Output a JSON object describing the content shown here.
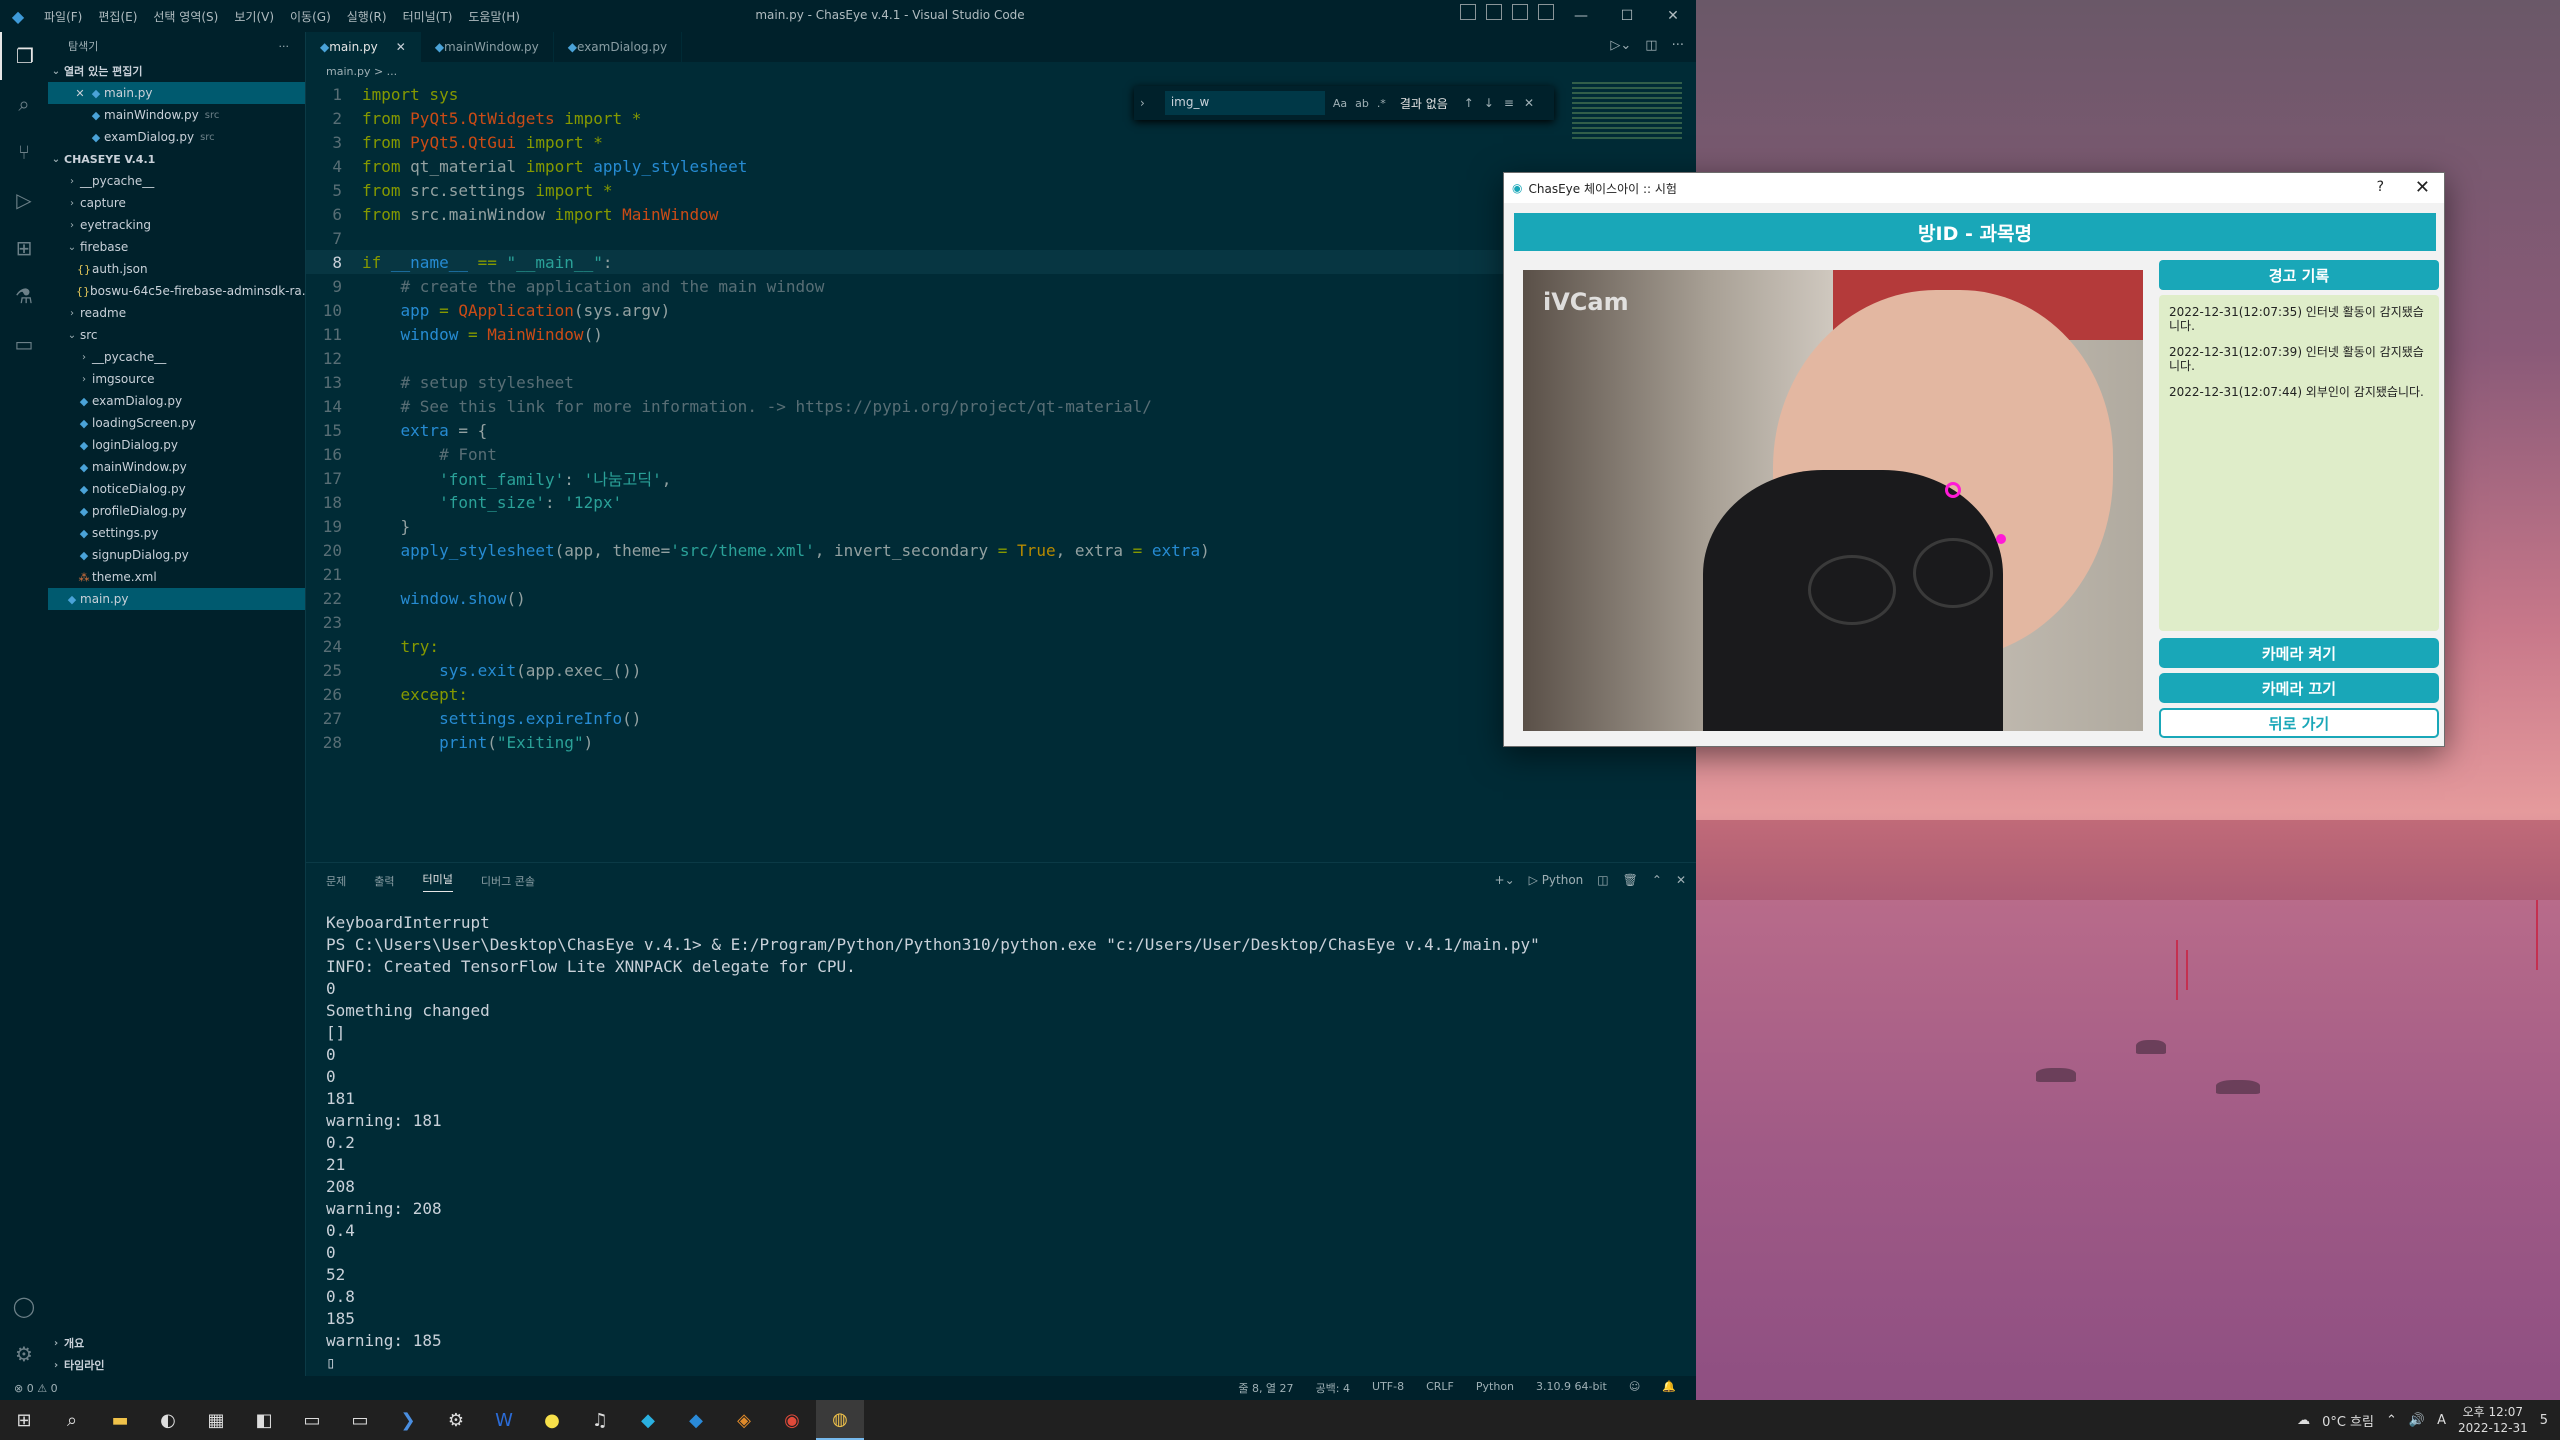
{
  "window_title": "main.py - ChasEye v.4.1 - Visual Studio Code",
  "menu": [
    "파일(F)",
    "편집(E)",
    "선택 영역(S)",
    "보기(V)",
    "이동(G)",
    "실행(R)",
    "터미널(T)",
    "도움말(H)"
  ],
  "sidebar": {
    "header": "탐색기",
    "open_editors_label": "열려 있는 편집기",
    "open_editors": [
      {
        "name": "main.py",
        "note": "",
        "close": "✕"
      },
      {
        "name": "mainWindow.py",
        "note": "src"
      },
      {
        "name": "examDialog.py",
        "note": "src"
      }
    ],
    "project_label": "CHASEYE V.4.1",
    "tree": [
      {
        "name": "__pycache__",
        "type": "folder",
        "depth": 1
      },
      {
        "name": "capture",
        "type": "folder",
        "depth": 1
      },
      {
        "name": "eyetracking",
        "type": "folder",
        "depth": 1
      },
      {
        "name": "firebase",
        "type": "folder-open",
        "depth": 1
      },
      {
        "name": "auth.json",
        "type": "json",
        "depth": 2
      },
      {
        "name": "boswu-64c5e-firebase-adminsdk-ra...",
        "type": "json",
        "depth": 2
      },
      {
        "name": "readme",
        "type": "folder",
        "depth": 1
      },
      {
        "name": "src",
        "type": "folder-open",
        "depth": 1
      },
      {
        "name": "__pycache__",
        "type": "folder",
        "depth": 2
      },
      {
        "name": "imgsource",
        "type": "folder",
        "depth": 2
      },
      {
        "name": "examDialog.py",
        "type": "py",
        "depth": 2
      },
      {
        "name": "loadingScreen.py",
        "type": "py",
        "depth": 2
      },
      {
        "name": "loginDialog.py",
        "type": "py",
        "depth": 2
      },
      {
        "name": "mainWindow.py",
        "type": "py",
        "depth": 2
      },
      {
        "name": "noticeDialog.py",
        "type": "py",
        "depth": 2
      },
      {
        "name": "profileDialog.py",
        "type": "py",
        "depth": 2
      },
      {
        "name": "settings.py",
        "type": "py",
        "depth": 2
      },
      {
        "name": "signupDialog.py",
        "type": "py",
        "depth": 2
      },
      {
        "name": "theme.xml",
        "type": "xml",
        "depth": 2
      },
      {
        "name": "main.py",
        "type": "py",
        "depth": 1
      }
    ],
    "bottom_sections": [
      "개요",
      "타임라인"
    ]
  },
  "tabs": [
    {
      "label": "main.py",
      "active": true
    },
    {
      "label": "mainWindow.py",
      "active": false
    },
    {
      "label": "examDialog.py",
      "active": false
    }
  ],
  "breadcrumb": "main.py > ...",
  "find": {
    "value": "img_w",
    "result": "결과 없음",
    "opt_case": "Aa",
    "opt_word": "ab",
    "opt_regex": ".*"
  },
  "code": [
    [
      [
        "import sys",
        "#859900"
      ]
    ],
    [
      [
        "from ",
        "#859900"
      ],
      [
        "PyQt5.QtWidgets",
        "#cb4b16"
      ],
      [
        " import *",
        "#859900"
      ]
    ],
    [
      [
        "from ",
        "#859900"
      ],
      [
        "PyQt5.QtGui",
        "#cb4b16"
      ],
      [
        " import *",
        "#859900"
      ]
    ],
    [
      [
        "from ",
        "#859900"
      ],
      [
        "qt_material",
        "#93a1a1"
      ],
      [
        " import ",
        "#859900"
      ],
      [
        "apply_stylesheet",
        "#268bd2"
      ]
    ],
    [
      [
        "from ",
        "#859900"
      ],
      [
        "src.settings",
        "#93a1a1"
      ],
      [
        " import *",
        "#859900"
      ]
    ],
    [
      [
        "from ",
        "#859900"
      ],
      [
        "src.mainWindow",
        "#93a1a1"
      ],
      [
        " import ",
        "#859900"
      ],
      [
        "MainWindow",
        "#cb4b16"
      ]
    ],
    [
      [
        "",
        ""
      ]
    ],
    [
      [
        "if ",
        "#859900"
      ],
      [
        "__name__",
        "#268bd2"
      ],
      [
        " == ",
        "#859900"
      ],
      [
        "\"__main__\"",
        "#2aa198"
      ],
      [
        ":",
        "#93a1a1"
      ]
    ],
    [
      [
        "    # create the application and the main window",
        "#586e75"
      ]
    ],
    [
      [
        "    app ",
        "#268bd2"
      ],
      [
        "= ",
        "#859900"
      ],
      [
        "QApplication",
        "#cb4b16"
      ],
      [
        "(sys.argv)",
        "#93a1a1"
      ]
    ],
    [
      [
        "    window ",
        "#268bd2"
      ],
      [
        "= ",
        "#859900"
      ],
      [
        "MainWindow",
        "#cb4b16"
      ],
      [
        "()",
        "#93a1a1"
      ]
    ],
    [
      [
        "",
        ""
      ]
    ],
    [
      [
        "    # setup stylesheet",
        "#586e75"
      ]
    ],
    [
      [
        "    # See this link for more information. -> https://pypi.org/project/qt-material/",
        "#586e75"
      ]
    ],
    [
      [
        "    extra ",
        "#268bd2"
      ],
      [
        "= {",
        "#93a1a1"
      ]
    ],
    [
      [
        "        # Font",
        "#586e75"
      ]
    ],
    [
      [
        "        'font_family'",
        "#2aa198"
      ],
      [
        ": ",
        "#93a1a1"
      ],
      [
        "'나눔고딕'",
        "#2aa198"
      ],
      [
        ",",
        "#93a1a1"
      ]
    ],
    [
      [
        "        'font_size'",
        "#2aa198"
      ],
      [
        ": ",
        "#93a1a1"
      ],
      [
        "'12px'",
        "#2aa198"
      ]
    ],
    [
      [
        "    }",
        "#93a1a1"
      ]
    ],
    [
      [
        "    apply_stylesheet",
        "#268bd2"
      ],
      [
        "(app, theme=",
        "#93a1a1"
      ],
      [
        "'src/theme.xml'",
        "#2aa198"
      ],
      [
        ", invert_secondary ",
        "#93a1a1"
      ],
      [
        "= ",
        "#859900"
      ],
      [
        "True",
        "#b58900"
      ],
      [
        ", extra ",
        "#93a1a1"
      ],
      [
        "= ",
        "#859900"
      ],
      [
        "extra",
        "#268bd2"
      ],
      [
        ")",
        "#93a1a1"
      ]
    ],
    [
      [
        "",
        ""
      ]
    ],
    [
      [
        "    window.show",
        "#268bd2"
      ],
      [
        "()",
        "#93a1a1"
      ]
    ],
    [
      [
        "",
        ""
      ]
    ],
    [
      [
        "    try:",
        "#859900"
      ]
    ],
    [
      [
        "        sys.exit",
        "#268bd2"
      ],
      [
        "(app.exec_())",
        "#93a1a1"
      ]
    ],
    [
      [
        "    except:",
        "#859900"
      ]
    ],
    [
      [
        "        settings.expireInfo",
        "#268bd2"
      ],
      [
        "()",
        "#93a1a1"
      ]
    ],
    [
      [
        "        print",
        "#268bd2"
      ],
      [
        "(",
        "#93a1a1"
      ],
      [
        "\"Exiting\"",
        "#2aa198"
      ],
      [
        ")",
        "#93a1a1"
      ]
    ]
  ],
  "panel": {
    "tabs": [
      "문제",
      "출력",
      "터미널",
      "디버그 콘솔"
    ],
    "active_tab": "터미널",
    "shell": "Python",
    "terminal": [
      "KeyboardInterrupt",
      "PS C:\\Users\\User\\Desktop\\ChasEye v.4.1> & E:/Program/Python/Python310/python.exe \"c:/Users/User/Desktop/ChasEye v.4.1/main.py\"",
      "INFO: Created TensorFlow Lite XNNPACK delegate for CPU.",
      "0",
      "Something changed",
      "[]",
      "0",
      "0",
      "181",
      "warning: 181",
      "0.2",
      "21",
      "208",
      "warning: 208",
      "0.4",
      "0",
      "52",
      "0.8",
      "185",
      "warning: 185",
      "▯"
    ]
  },
  "status": {
    "left": "⊗ 0 ⚠ 0",
    "position": "줄 8, 열 27",
    "spaces": "공백: 4",
    "encoding": "UTF-8",
    "eol": "CRLF",
    "language": "Python",
    "interpreter": "3.10.9 64-bit"
  },
  "dialog": {
    "title": "ChasEye 체이스아이 :: 시험",
    "help": "?",
    "close": "✕",
    "room": "방ID - 과목명",
    "cam_watermark": "iVCam",
    "warn_header": "경고 기록",
    "warnings": [
      "2022-12-31(12:07:35) 인터넷 활동이 감지됐습니다.",
      "2022-12-31(12:07:39) 인터넷 활동이 감지됐습니다.",
      "2022-12-31(12:07:44) 외부인이 감지됐습니다."
    ],
    "btn_cam_on": "카메라 켜기",
    "btn_cam_off": "카메라 끄기",
    "btn_back": "뒤로 가기",
    "accent": "#19a7b8"
  },
  "taskbar": {
    "weather": "0°C 흐림",
    "time": "오후 12:07",
    "date": "2022-12-31",
    "notif": "5"
  }
}
